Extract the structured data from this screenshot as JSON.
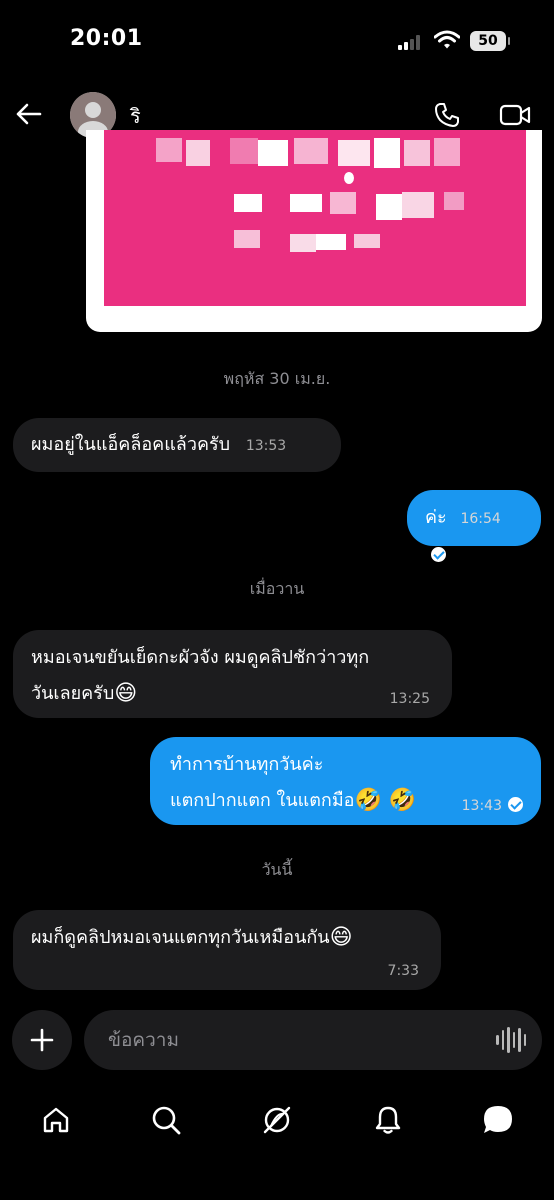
{
  "status_bar": {
    "time": "20:01",
    "battery": "50"
  },
  "header": {
    "contact_name": "ริ"
  },
  "separators": {
    "thursday": "พฤหัส 30 เม.ย.",
    "yesterday": "เมื่อวาน",
    "today": "วันนี้"
  },
  "messages": [
    {
      "direction": "in",
      "text": "ผมอยู่ในแอ็คล็อคแล้วครับ",
      "time": "13:53"
    },
    {
      "direction": "out",
      "text": "ค่ะ",
      "time": "16:54"
    },
    {
      "direction": "in",
      "line1": "หมอเจนขยันเย็ดกะผัวจัง ผมดูคลิปชักว่าวทุก",
      "line2": "วันเลยครับ",
      "emoji": "😄",
      "time": "13:25"
    },
    {
      "direction": "out",
      "line1": "ทำการบ้านทุกวันค่ะ",
      "line2": "แตกปากแตก ในแตกมือ",
      "emoji": "🤣 🤣",
      "time": "13:43"
    },
    {
      "direction": "in",
      "text": "ผมก็ดูคลิปหมอเจนแตกทุกวันเหมือนกัน",
      "emoji": "😄",
      "time": "7:33"
    }
  ],
  "composer": {
    "placeholder": "ข้อความ"
  },
  "colors": {
    "background": "#000000",
    "incoming_bubble": "#1c1c1e",
    "outgoing_bubble": "#1a97f0",
    "image_pink": "#ea2f80"
  },
  "icons": [
    "back-arrow-icon",
    "phone-icon",
    "video-call-icon",
    "plus-icon",
    "voice-wave-icon",
    "home-icon",
    "search-icon",
    "explore-icon",
    "bell-icon",
    "chat-icon"
  ]
}
